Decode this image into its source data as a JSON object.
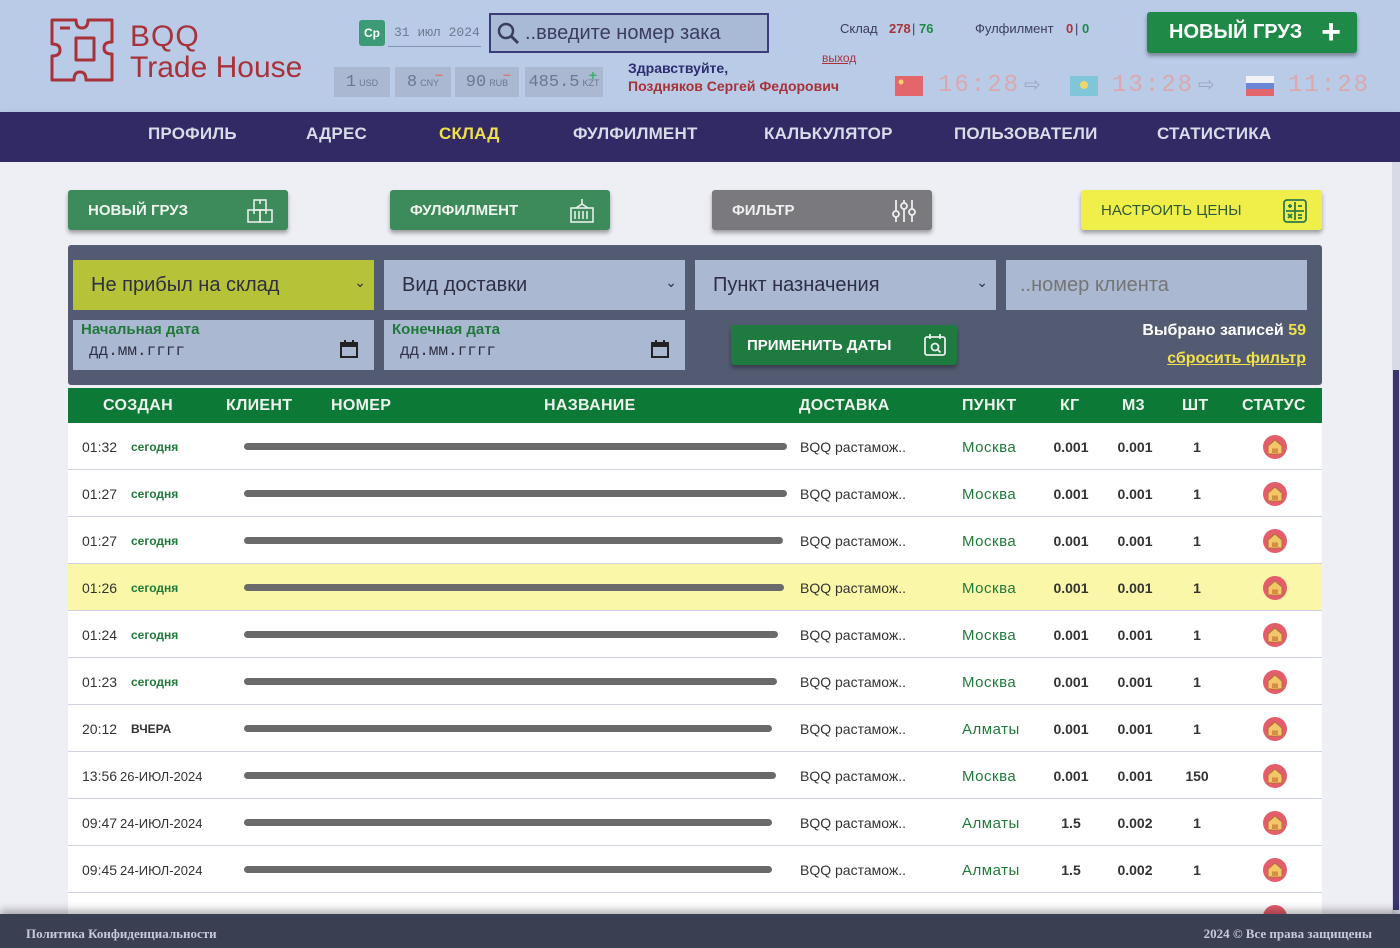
{
  "header": {
    "logo_line1": "BQQ",
    "logo_line2": "Trade House",
    "day_badge": "Ср",
    "date": "31 июл 2024",
    "search_placeholder": "..введите номер зака",
    "currencies": [
      {
        "value": "1",
        "code": "USD",
        "mark": ""
      },
      {
        "value": "8",
        "code": "CNY",
        "mark": "−"
      },
      {
        "value": "90",
        "code": "RUB",
        "mark": "−"
      },
      {
        "value": "485.5",
        "code": "KZT",
        "mark": "+"
      }
    ],
    "greeting": "Здравствуйте,",
    "user_name": "Поздняков Сергей Федорович",
    "warehouse_label": "Склад",
    "warehouse_val1": "278",
    "warehouse_val2": "76",
    "fulfillment_label": "Фулфилмент",
    "fulfillment_val1": "0",
    "fulfillment_val2": "0",
    "separator": "|",
    "exit": "выход",
    "clocks": [
      "16:28",
      "13:28",
      "11:28"
    ],
    "new_cargo": "НОВЫЙ ГРУЗ",
    "colors": {
      "accent_green": "#1f8a48",
      "brand_red": "#a8323a",
      "nav_bg": "#312a64",
      "highlight_yellow": "#f0e04c"
    }
  },
  "nav": {
    "items": [
      "ПРОФИЛЬ",
      "АДРЕС",
      "СКЛАД",
      "ФУЛФИЛМЕНТ",
      "КАЛЬКУЛЯТОР",
      "ПОЛЬЗОВАТЕЛИ",
      "СТАТИСТИКА"
    ],
    "active": "СКЛАД"
  },
  "actions": {
    "new_cargo": "НОВЫЙ ГРУЗ",
    "fulfillment": "ФУЛФИЛМЕНТ",
    "filter": "ФИЛЬТР",
    "prices": "НАСТРОИТЬ ЦЕНЫ"
  },
  "filters": {
    "status": "Не прибыл на склад",
    "delivery": "Вид доставки",
    "destination": "Пункт назначения",
    "client_placeholder": "..номер клиента",
    "start_date_label": "Начальная дата",
    "end_date_label": "Конечная дата",
    "date_placeholder": "дд.мм.гггг",
    "apply": "ПРИМЕНИТЬ ДАТЫ",
    "records_label": "Выбрано записей",
    "records_count": "59",
    "reset": "сбросить фильтр"
  },
  "table": {
    "columns": [
      "СОЗДАН",
      "КЛИЕНТ",
      "НОМЕР",
      "НАЗВАНИЕ",
      "ДОСТАВКА",
      "ПУНКТ",
      "КГ",
      "М3",
      "ШТ",
      "СТАТУС"
    ],
    "rows": [
      {
        "time": "01:32",
        "when": "сегодня",
        "kind": "today",
        "delivery": "BQQ растамож..",
        "city": "Москва",
        "kg": "0.001",
        "m3": "0.001",
        "qty": "1",
        "highlight": false
      },
      {
        "time": "01:27",
        "when": "сегодня",
        "kind": "today",
        "delivery": "BQQ растамож..",
        "city": "Москва",
        "kg": "0.001",
        "m3": "0.001",
        "qty": "1",
        "highlight": false
      },
      {
        "time": "01:27",
        "when": "сегодня",
        "kind": "today",
        "delivery": "BQQ растамож..",
        "city": "Москва",
        "kg": "0.001",
        "m3": "0.001",
        "qty": "1",
        "highlight": false
      },
      {
        "time": "01:26",
        "when": "сегодня",
        "kind": "today",
        "delivery": "BQQ растамож..",
        "city": "Москва",
        "kg": "0.001",
        "m3": "0.001",
        "qty": "1",
        "highlight": true
      },
      {
        "time": "01:24",
        "when": "сегодня",
        "kind": "today",
        "delivery": "BQQ растамож..",
        "city": "Москва",
        "kg": "0.001",
        "m3": "0.001",
        "qty": "1",
        "highlight": false
      },
      {
        "time": "01:23",
        "when": "сегодня",
        "kind": "today",
        "delivery": "BQQ растамож..",
        "city": "Москва",
        "kg": "0.001",
        "m3": "0.001",
        "qty": "1",
        "highlight": false
      },
      {
        "time": "20:12",
        "when": "ВЧЕРА",
        "kind": "yesterday",
        "delivery": "BQQ растамож..",
        "city": "Алматы",
        "kg": "0.001",
        "m3": "0.001",
        "qty": "1",
        "highlight": false
      },
      {
        "time": "13:56",
        "when": "26-ИЮЛ-2024",
        "kind": "date",
        "delivery": "BQQ растамож..",
        "city": "Москва",
        "kg": "0.001",
        "m3": "0.001",
        "qty": "150",
        "highlight": false
      },
      {
        "time": "09:47",
        "when": "24-ИЮЛ-2024",
        "kind": "date",
        "delivery": "BQQ растамож..",
        "city": "Алматы",
        "kg": "1.5",
        "m3": "0.002",
        "qty": "1",
        "highlight": false
      },
      {
        "time": "09:45",
        "when": "24-ИЮЛ-2024",
        "kind": "date",
        "delivery": "BQQ растамож..",
        "city": "Алматы",
        "kg": "1.5",
        "m3": "0.002",
        "qty": "1",
        "highlight": false
      }
    ]
  },
  "footer": {
    "privacy": "Политика Конфиденциальности",
    "copyright": "2024 © Все права защищены"
  }
}
